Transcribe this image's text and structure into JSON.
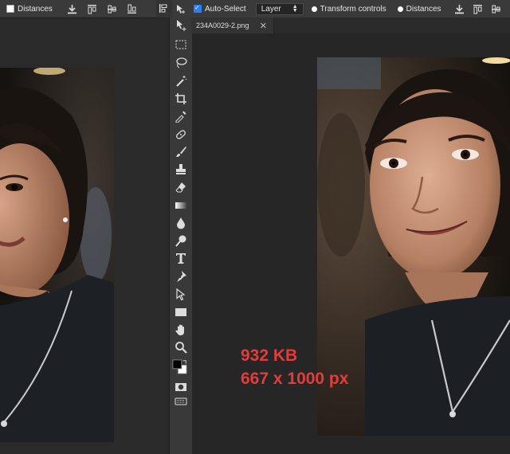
{
  "options_bar_left": {
    "distances_label": "Distances"
  },
  "options_bar_right": {
    "auto_select_label": "Auto-Select",
    "layer_select_value": "Layer",
    "transform_controls_label": "Transform controls",
    "distances_label": "Distances"
  },
  "document_tab": {
    "filename": "234A0029-2.png",
    "close_glyph": "✕"
  },
  "overlay": {
    "file_size": "932 KB",
    "dimensions": "667 x 1000 px"
  },
  "colors": {
    "overlay_text": "#e53b3b",
    "toolbar_bg": "#393939",
    "options_bg": "#3a3a3a",
    "canvas_bg": "#262626"
  },
  "tools": [
    "move-icon",
    "marquee-icon",
    "lasso-icon",
    "magic-wand-icon",
    "crop-icon",
    "eyedropper-icon",
    "healing-brush-icon",
    "brush-icon",
    "clone-stamp-icon",
    "eraser-icon",
    "gradient-icon",
    "blur-icon",
    "dodge-icon",
    "type-icon",
    "pen-icon",
    "path-select-icon",
    "rectangle-icon",
    "hand-icon",
    "zoom-icon",
    "color-swatches-icon",
    "quick-mask-icon",
    "keyboard-icon"
  ]
}
